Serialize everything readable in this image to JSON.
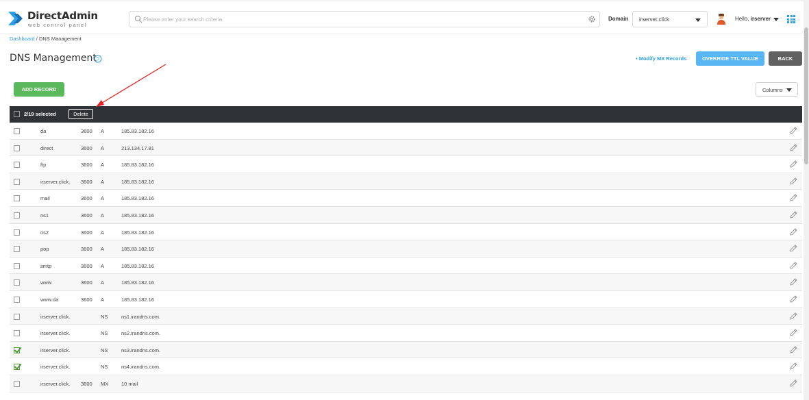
{
  "header": {
    "logo_title": "DirectAdmin",
    "logo_subtitle": "web control panel",
    "search_placeholder": "Please enter your search criteria",
    "domain_label": "Domain",
    "domain_value": "irserver.click",
    "hello_prefix": "Hello,",
    "username": "irserver"
  },
  "breadcrumb": {
    "link": "Dashboard",
    "separator": " / ",
    "current": "DNS Management"
  },
  "page": {
    "title": "DNS Management",
    "modify_mx_link": "• Modify MX Records",
    "override_ttl_button": "OVERRIDE TTL VALUE",
    "back_button": "BACK",
    "add_record_button": "ADD RECORD",
    "columns_button": "Columns"
  },
  "table": {
    "selection_text": "2/19 selected",
    "delete_button": "Delete",
    "rows": [
      {
        "name": "da",
        "ttl": "3600",
        "type": "A",
        "value": "185.83.182.16",
        "checked": false
      },
      {
        "name": "direct",
        "ttl": "3600",
        "type": "A",
        "value": "213.134.17.81",
        "checked": false
      },
      {
        "name": "ftp",
        "ttl": "3600",
        "type": "A",
        "value": "185.83.182.16",
        "checked": false
      },
      {
        "name": "irserver.click.",
        "ttl": "3600",
        "type": "A",
        "value": "185.83.182.16",
        "checked": false
      },
      {
        "name": "mail",
        "ttl": "3600",
        "type": "A",
        "value": "185.83.182.16",
        "checked": false
      },
      {
        "name": "ns1",
        "ttl": "3600",
        "type": "A",
        "value": "185.83.182.16",
        "checked": false
      },
      {
        "name": "ns2",
        "ttl": "3600",
        "type": "A",
        "value": "185.83.182.16",
        "checked": false
      },
      {
        "name": "pop",
        "ttl": "3600",
        "type": "A",
        "value": "185.83.182.16",
        "checked": false
      },
      {
        "name": "smtp",
        "ttl": "3600",
        "type": "A",
        "value": "185.83.182.16",
        "checked": false
      },
      {
        "name": "www",
        "ttl": "3600",
        "type": "A",
        "value": "185.83.182.16",
        "checked": false
      },
      {
        "name": "www.da",
        "ttl": "3600",
        "type": "A",
        "value": "185.83.182.16",
        "checked": false
      },
      {
        "name": "irserver.click.",
        "ttl": "",
        "type": "NS",
        "value": "ns1.irandns.com.",
        "checked": false
      },
      {
        "name": "irserver.click.",
        "ttl": "",
        "type": "NS",
        "value": "ns2.irandns.com.",
        "checked": false
      },
      {
        "name": "irserver.click.",
        "ttl": "",
        "type": "NS",
        "value": "ns3.irandns.com.",
        "checked": true
      },
      {
        "name": "irserver.click.",
        "ttl": "",
        "type": "NS",
        "value": "ns4.irandns.com.",
        "checked": true
      },
      {
        "name": "irserver.click.",
        "ttl": "3600",
        "type": "MX",
        "value": "10 mail",
        "checked": false
      }
    ]
  },
  "colors": {
    "accent_blue": "#2b9fe8",
    "add_green": "#5cb85c",
    "table_header": "#2f3236",
    "annotation_arrow": "#e8231f"
  }
}
